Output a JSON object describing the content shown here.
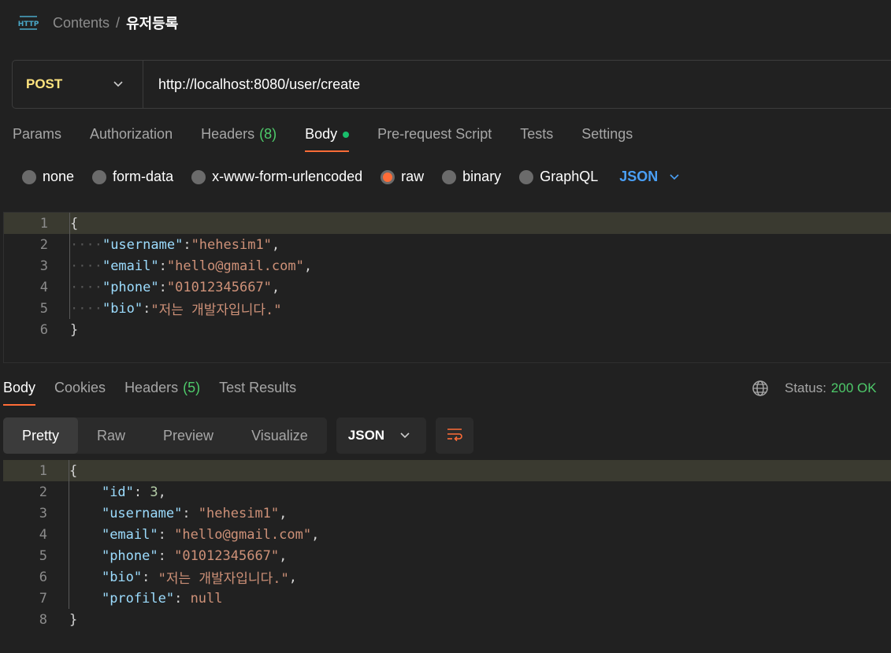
{
  "breadcrumb": {
    "icon": "http-icon",
    "parent": "Contents",
    "separator": "/",
    "title": "유저등록"
  },
  "request": {
    "method": "POST",
    "url": "http://localhost:8080/user/create"
  },
  "request_tabs": [
    {
      "label": "Params"
    },
    {
      "label": "Authorization"
    },
    {
      "label": "Headers",
      "count": "(8)"
    },
    {
      "label": "Body",
      "active": true
    },
    {
      "label": "Pre-request Script"
    },
    {
      "label": "Tests"
    },
    {
      "label": "Settings"
    }
  ],
  "body_types": {
    "options": [
      "none",
      "form-data",
      "x-www-form-urlencoded",
      "raw",
      "binary",
      "GraphQL"
    ],
    "selected": "raw",
    "format": "JSON"
  },
  "request_body_lines": [
    {
      "n": "1",
      "text": "{"
    },
    {
      "n": "2",
      "key": "\"username\"",
      "value": "\"hehesim1\""
    },
    {
      "n": "3",
      "key": "\"email\"",
      "value": "\"hello@gmail.com\""
    },
    {
      "n": "4",
      "key": "\"phone\"",
      "value": "\"01012345667\""
    },
    {
      "n": "5",
      "key": "\"bio\"",
      "value": "\"저는 개발자입니다.\""
    },
    {
      "n": "6",
      "text": "}"
    }
  ],
  "response_tabs": [
    {
      "label": "Body",
      "active": true
    },
    {
      "label": "Cookies"
    },
    {
      "label": "Headers",
      "count": "(5)"
    },
    {
      "label": "Test Results"
    }
  ],
  "status": {
    "label": "Status:",
    "value": "200 OK"
  },
  "view_modes": [
    "Pretty",
    "Raw",
    "Preview",
    "Visualize"
  ],
  "view_format": "JSON",
  "response_body_lines": [
    {
      "n": "1",
      "text": "{"
    },
    {
      "n": "2",
      "key": "\"id\"",
      "value": "3"
    },
    {
      "n": "3",
      "key": "\"username\"",
      "value": "\"hehesim1\""
    },
    {
      "n": "4",
      "key": "\"email\"",
      "value": "\"hello@gmail.com\""
    },
    {
      "n": "5",
      "key": "\"phone\"",
      "value": "\"01012345667\""
    },
    {
      "n": "6",
      "key": "\"bio\"",
      "value": "\"저는 개발자입니다.\""
    },
    {
      "n": "7",
      "key": "\"profile\"",
      "value": "null"
    },
    {
      "n": "8",
      "text": "}"
    }
  ],
  "colors": {
    "accent": "#ff6c37",
    "method": "#ffe47e",
    "status_ok": "#4eca6a",
    "link_blue": "#4a9ff5"
  }
}
